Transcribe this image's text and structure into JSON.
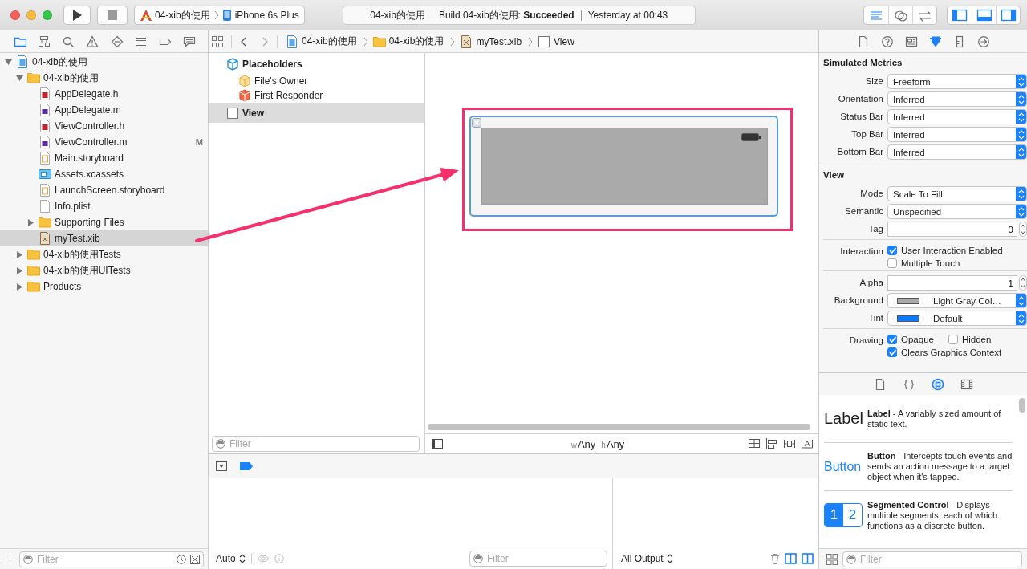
{
  "toolbar": {
    "scheme": "04-xib的使用",
    "device": "iPhone 6s Plus",
    "activity": {
      "project": "04-xib的使用",
      "status": "Build 04-xib的使用: **Succeeded**",
      "time": "Yesterday at 00:43"
    },
    "editor_modes": [
      {
        "kind": "standard",
        "selected": true
      },
      {
        "kind": "assistant",
        "selected": false
      },
      {
        "kind": "version",
        "selected": false
      }
    ],
    "panel_toggles": [
      {
        "kind": "navigator",
        "on": true
      },
      {
        "kind": "debug",
        "on": true
      },
      {
        "kind": "utilities",
        "on": true
      }
    ]
  },
  "navigator": {
    "tabs": [
      {
        "kind": "project",
        "selected": true
      },
      {
        "kind": "symbol",
        "selected": false
      },
      {
        "kind": "find",
        "selected": false
      },
      {
        "kind": "issue",
        "selected": false
      },
      {
        "kind": "test",
        "selected": false
      },
      {
        "kind": "debug",
        "selected": false
      },
      {
        "kind": "breakpoint",
        "selected": false
      },
      {
        "kind": "report",
        "selected": false
      }
    ],
    "tree": [
      {
        "label": "04-xib的使用",
        "kind": "project",
        "expanded": true,
        "selected": false,
        "children": [
          {
            "label": "04-xib的使用",
            "kind": "folder",
            "expanded": true,
            "selected": false,
            "children": [
              {
                "label": "AppDelegate.h",
                "kind": "header",
                "selected": false
              },
              {
                "label": "AppDelegate.m",
                "kind": "source",
                "selected": false
              },
              {
                "label": "ViewController.h",
                "kind": "header",
                "selected": false
              },
              {
                "label": "ViewController.m",
                "kind": "source",
                "selected": false,
                "badge": "M"
              },
              {
                "label": "Main.storyboard",
                "kind": "storyboard",
                "selected": false
              },
              {
                "label": "Assets.xcassets",
                "kind": "assets",
                "selected": false
              },
              {
                "label": "LaunchScreen.storyboard",
                "kind": "storyboard",
                "selected": false
              },
              {
                "label": "Info.plist",
                "kind": "plist",
                "selected": false
              },
              {
                "label": "Supporting Files",
                "kind": "folder",
                "expanded": false,
                "selected": false
              },
              {
                "label": "myTest.xib",
                "kind": "xib",
                "selected": true
              }
            ]
          },
          {
            "label": "04-xib的使用Tests",
            "kind": "folder",
            "expanded": false,
            "selected": false
          },
          {
            "label": "04-xib的使用UITests",
            "kind": "folder",
            "expanded": false,
            "selected": false
          },
          {
            "label": "Products",
            "kind": "folder",
            "expanded": false,
            "selected": false
          }
        ]
      }
    ],
    "filter": {
      "placeholder": "Filter"
    }
  },
  "editor": {
    "jump_bar": [
      {
        "label": "04-xib的使用",
        "kind": "project"
      },
      {
        "label": "04-xib的使用",
        "kind": "folder"
      },
      {
        "label": "myTest.xib",
        "kind": "xib"
      },
      {
        "label": "View",
        "kind": "view"
      }
    ],
    "outline": [
      {
        "label": "Placeholders",
        "kind": "group",
        "selected": false,
        "children": [
          {
            "label": "File's Owner",
            "kind": "owner",
            "selected": false
          },
          {
            "label": "First Responder",
            "kind": "responder",
            "selected": false
          }
        ]
      },
      {
        "label": "View",
        "kind": "view",
        "selected": true
      }
    ],
    "outline_filter": {
      "placeholder": "Filter"
    },
    "size_class": {
      "width_prefix": "w",
      "width": "Any",
      "height_prefix": "h",
      "height": "Any"
    }
  },
  "debug": {
    "variables_scope": "Auto",
    "variables_filter": {
      "placeholder": "Filter"
    },
    "console_output": "All Output"
  },
  "inspector": {
    "tabs": [
      {
        "kind": "file",
        "selected": false
      },
      {
        "kind": "help",
        "selected": false
      },
      {
        "kind": "identity",
        "selected": false
      },
      {
        "kind": "attributes",
        "selected": true
      },
      {
        "kind": "size",
        "selected": false
      },
      {
        "kind": "connections",
        "selected": false
      }
    ],
    "sections": [
      {
        "title": "Simulated Metrics",
        "groups": [
          [
            {
              "kind": "popup",
              "label": "Size",
              "value": "Freeform"
            },
            {
              "kind": "popup",
              "label": "Orientation",
              "value": "Inferred"
            },
            {
              "kind": "popup",
              "label": "Status Bar",
              "value": "Inferred"
            },
            {
              "kind": "popup",
              "label": "Top Bar",
              "value": "Inferred"
            },
            {
              "kind": "popup",
              "label": "Bottom Bar",
              "value": "Inferred"
            }
          ]
        ]
      },
      {
        "title": "View",
        "groups": [
          [
            {
              "kind": "popup",
              "label": "Mode",
              "value": "Scale To Fill"
            },
            {
              "kind": "popup",
              "label": "Semantic",
              "value": "Unspecified"
            },
            {
              "kind": "stepper",
              "label": "Tag",
              "value": "0"
            }
          ],
          [
            {
              "kind": "checks",
              "label": "Interaction",
              "lines": [
                [
                  {
                    "label": "User Interaction Enabled",
                    "checked": true
                  }
                ],
                [
                  {
                    "label": "Multiple Touch",
                    "checked": false
                  }
                ]
              ]
            }
          ],
          [
            {
              "kind": "stepper",
              "label": "Alpha",
              "value": "1"
            },
            {
              "kind": "color",
              "label": "Background",
              "color": "#aaaaaa",
              "value": "Light Gray Col…"
            },
            {
              "kind": "color",
              "label": "Tint",
              "color": "#0a7aff",
              "value": "Default"
            }
          ],
          [
            {
              "kind": "checks",
              "label": "Drawing",
              "lines": [
                [
                  {
                    "label": "Opaque",
                    "checked": true
                  },
                  {
                    "label": "Hidden",
                    "checked": false
                  }
                ],
                [
                  {
                    "label": "Clears Graphics Context",
                    "checked": true
                  }
                ]
              ]
            }
          ]
        ]
      }
    ]
  },
  "library": {
    "tabs": [
      {
        "kind": "file",
        "selected": false
      },
      {
        "kind": "code",
        "selected": false
      },
      {
        "kind": "object",
        "selected": true
      },
      {
        "kind": "media",
        "selected": false
      }
    ],
    "items": [
      {
        "kind": "label",
        "preview": "Label",
        "text": "**Label** - A variably sized amount of static text."
      },
      {
        "kind": "button",
        "preview": "Button",
        "text": "**Button** - Intercepts touch events and sends an action message to a target object when it's tapped."
      },
      {
        "kind": "segmented",
        "segments": [
          "1",
          "2"
        ],
        "text": "**Segmented Control** - Displays multiple segments, each of which functions as a discrete button."
      }
    ],
    "filter": {
      "placeholder": "Filter"
    }
  }
}
